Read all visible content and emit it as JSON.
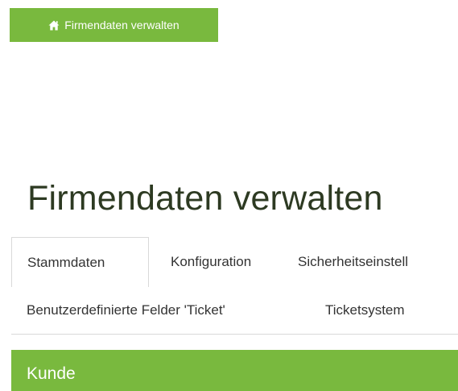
{
  "header": {
    "crumb_button_label": "Firmendaten verwalten",
    "crumb_icon": "home-icon"
  },
  "main": {
    "title": "Firmendaten verwalten",
    "tabs": [
      {
        "label": "Stammdaten",
        "active": true
      },
      {
        "label": "Konfiguration",
        "active": false
      },
      {
        "label": "Sicherheitseinstell",
        "active": false
      },
      {
        "label": "Benutzerdefinierte Felder 'Ticket'",
        "active": false
      },
      {
        "label": "Ticketsystem",
        "active": false
      }
    ],
    "section_title": "Kunde"
  },
  "colors": {
    "accent": "#79b93e",
    "title_text": "#2d3a22",
    "tab_border": "#d9d9d9"
  }
}
